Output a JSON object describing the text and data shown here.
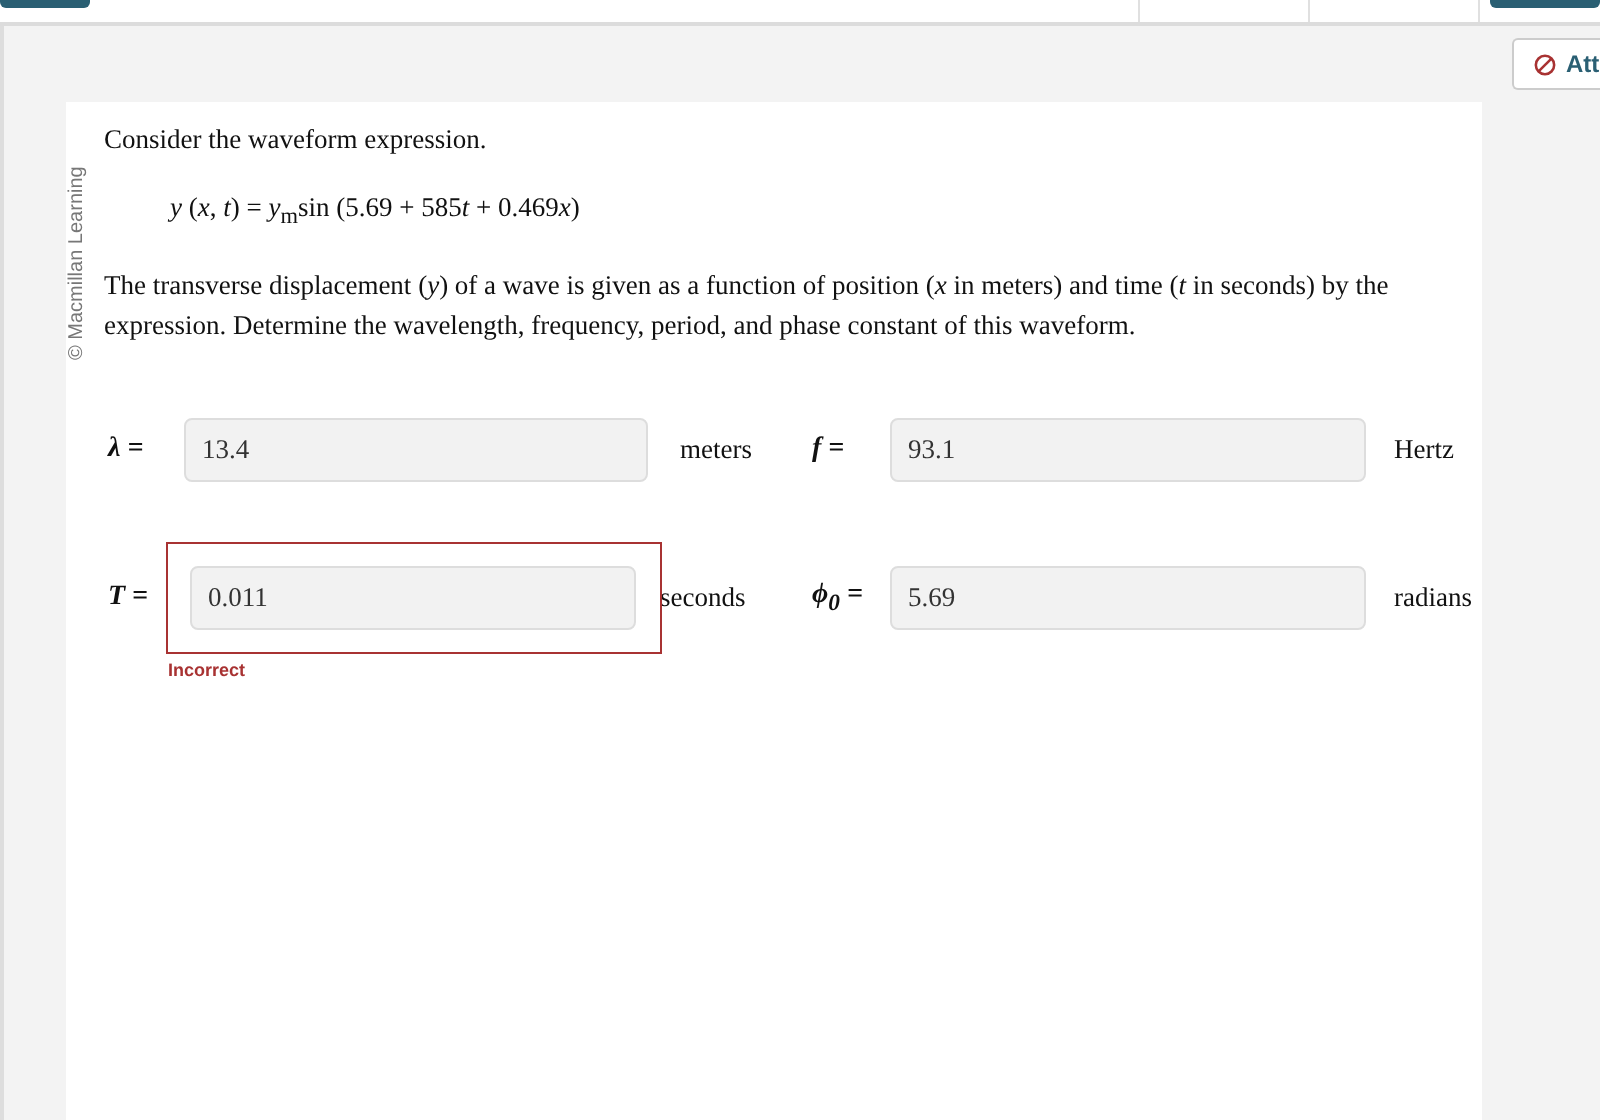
{
  "toolbar": {
    "button": "Att"
  },
  "copyright": "© Macmillan Learning",
  "question": {
    "intro": "Consider the waveform expression.",
    "equation": [
      {
        "text": "y",
        "italic": true
      },
      {
        "text": " (",
        "italic": false
      },
      {
        "text": "x",
        "italic": true
      },
      {
        "text": ", ",
        "italic": false
      },
      {
        "text": "t",
        "italic": true
      },
      {
        "text": ") = ",
        "italic": false
      },
      {
        "text": "y",
        "italic": true
      },
      {
        "text": "$_{m}$sin (5.69 + 585",
        "italic": false
      },
      {
        "text": "t",
        "italic": true
      },
      {
        "text": " + 0.469",
        "italic": false
      },
      {
        "text": "x",
        "italic": true
      },
      {
        "text": ")",
        "italic": false
      }
    ],
    "text": "The transverse displacement (*y*) of a wave is given as a function of position (*x* in meters) and time (*t* in seconds) by the expression. Determine the wavelength, frequency, period, and phase constant of this waveform."
  },
  "answers": [
    {
      "label": "λ =",
      "value": "13.4",
      "unit": "meters",
      "incorrect": false
    },
    {
      "label": "f =",
      "value": "93.1",
      "unit": "Hertz",
      "incorrect": false
    },
    {
      "label": "T =",
      "value": "0.011",
      "unit": "seconds",
      "incorrect": true,
      "feedback": "Incorrect"
    },
    {
      "label": "ϕ$_{0}$ =",
      "value": "5.69",
      "unit": "radians",
      "incorrect": false
    }
  ]
}
